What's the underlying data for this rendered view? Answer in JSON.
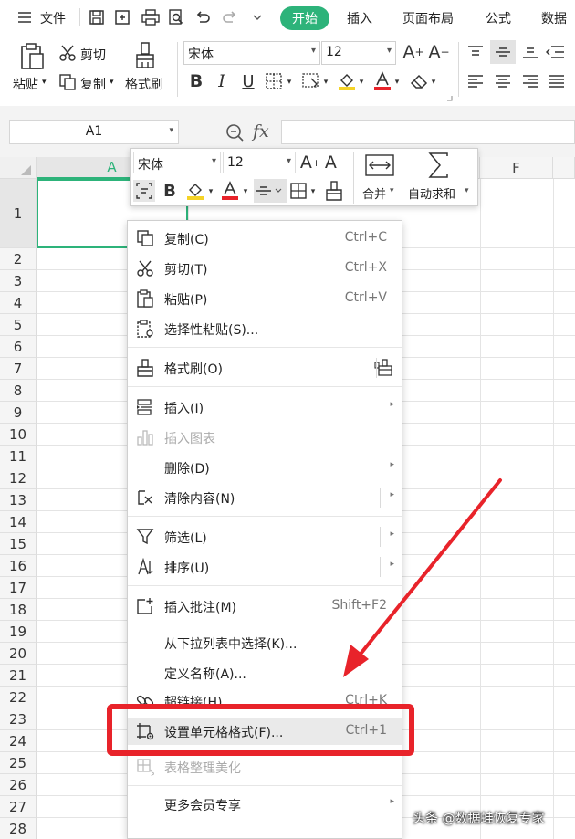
{
  "menubar": {
    "file_label": "文件",
    "tabs": [
      "开始",
      "插入",
      "页面布局",
      "公式",
      "数据"
    ]
  },
  "ribbon": {
    "paste_label": "粘贴",
    "cut_label": "剪切",
    "copy_label": "复制",
    "format_painter_label": "格式刷",
    "font_name": "宋体",
    "font_size": "12"
  },
  "formula_bar": {
    "name_box": "A1",
    "fx_label": "fx"
  },
  "grid": {
    "columns": [
      "A",
      "F"
    ],
    "rows": [
      "1",
      "2",
      "3",
      "4",
      "5",
      "6",
      "7",
      "8",
      "9",
      "10",
      "11",
      "12",
      "13",
      "14",
      "15",
      "16",
      "17",
      "18",
      "19",
      "20",
      "21",
      "22",
      "23",
      "24",
      "25",
      "26",
      "27",
      "28"
    ]
  },
  "mini_toolbar": {
    "font_name": "宋体",
    "font_size": "12",
    "merge_label": "合并",
    "autosum_label": "自动求和"
  },
  "context_menu": {
    "items": [
      {
        "label": "复制(C)",
        "shortcut": "Ctrl+C"
      },
      {
        "label": "剪切(T)",
        "shortcut": "Ctrl+X"
      },
      {
        "label": "粘贴(P)",
        "shortcut": "Ctrl+V"
      },
      {
        "label": "选择性粘贴(S)...",
        "shortcut": ""
      },
      {
        "label": "格式刷(O)",
        "shortcut": ""
      },
      {
        "label": "插入(I)",
        "shortcut": ""
      },
      {
        "label": "插入图表",
        "shortcut": ""
      },
      {
        "label": "删除(D)",
        "shortcut": ""
      },
      {
        "label": "清除内容(N)",
        "shortcut": ""
      },
      {
        "label": "筛选(L)",
        "shortcut": ""
      },
      {
        "label": "排序(U)",
        "shortcut": ""
      },
      {
        "label": "插入批注(M)",
        "shortcut": "Shift+F2"
      },
      {
        "label": "从下拉列表中选择(K)...",
        "shortcut": ""
      },
      {
        "label": "定义名称(A)...",
        "shortcut": ""
      },
      {
        "label": "超链接(H)...",
        "shortcut": "Ctrl+K"
      },
      {
        "label": "设置单元格格式(F)...",
        "shortcut": "Ctrl+1"
      },
      {
        "label": "表格整理美化",
        "shortcut": ""
      },
      {
        "label": "更多会员专享",
        "shortcut": ""
      }
    ]
  },
  "watermark": "头条 @数据蛙恢复专家",
  "colors": {
    "accent": "#2db37a",
    "highlight": "#e8232a",
    "arrow": "#e8232a"
  }
}
